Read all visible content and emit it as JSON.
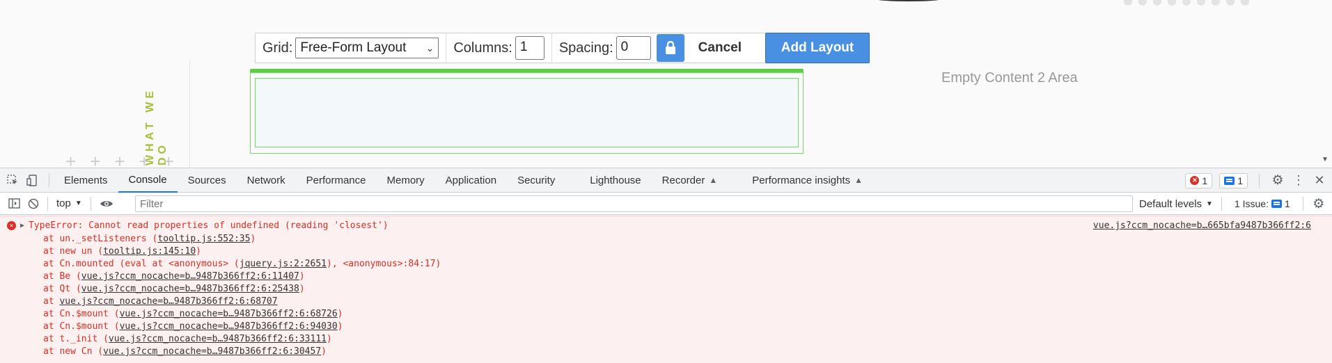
{
  "toolbar": {
    "grid_label": "Grid:",
    "grid_value": "Free-Form Layout",
    "columns_label": "Columns:",
    "columns_value": "1",
    "spacing_label": "Spacing:",
    "spacing_value": "0",
    "cancel_label": "Cancel",
    "add_label": "Add Layout"
  },
  "page": {
    "vertical_heading": "WHAT WE DO",
    "empty_area": "Empty Content 2 Area"
  },
  "devtools": {
    "tabs": [
      "Elements",
      "Console",
      "Sources",
      "Network",
      "Performance",
      "Memory",
      "Application",
      "Security",
      "Lighthouse",
      "Recorder",
      "Performance insights"
    ],
    "active_tab": "Console",
    "error_count": "1",
    "message_count": "1",
    "context": "top",
    "filter_placeholder": "Filter",
    "levels": "Default levels",
    "issues_label": "1 Issue:",
    "issues_count": "1"
  },
  "console": {
    "error_message": "TypeError: Cannot read properties of undefined (reading 'closest')",
    "source": "vue.js?ccm_nocache=b…665bfa9487b366ff2:6",
    "stack": [
      {
        "prefix": "at un._setListeners (",
        "link": "tooltip.js:552:35",
        "suffix": ")"
      },
      {
        "prefix": "at new un (",
        "link": "tooltip.js:145:10",
        "suffix": ")"
      },
      {
        "prefix": "at Cn.mounted (eval at <anonymous> (",
        "link": "jquery.js:2:2651",
        "suffix": "), <anonymous>:84:17)"
      },
      {
        "prefix": "at Be (",
        "link": "vue.js?ccm_nocache=b…9487b366ff2:6:11407",
        "suffix": ")"
      },
      {
        "prefix": "at Qt (",
        "link": "vue.js?ccm_nocache=b…9487b366ff2:6:25438",
        "suffix": ")"
      },
      {
        "prefix": "at ",
        "link": "vue.js?ccm_nocache=b…9487b366ff2:6:68707",
        "suffix": ""
      },
      {
        "prefix": "at Cn.$mount (",
        "link": "vue.js?ccm_nocache=b…9487b366ff2:6:68726",
        "suffix": ")"
      },
      {
        "prefix": "at Cn.$mount (",
        "link": "vue.js?ccm_nocache=b…9487b366ff2:6:94030",
        "suffix": ")"
      },
      {
        "prefix": "at t._init (",
        "link": "vue.js?ccm_nocache=b…9487b366ff2:6:33111",
        "suffix": ")"
      },
      {
        "prefix": "at new Cn (",
        "link": "vue.js?ccm_nocache=b…9487b366ff2:6:30457",
        "suffix": ")"
      }
    ]
  },
  "colors": {
    "accent": "#4a90e2",
    "green": "#54d33f",
    "error": "#d93025",
    "olive_heading": "#a8bf3a"
  }
}
